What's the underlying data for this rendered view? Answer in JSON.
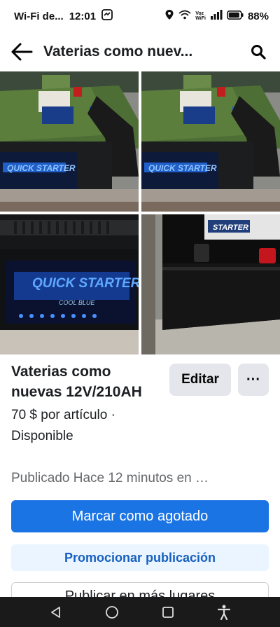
{
  "status_bar": {
    "carrier": "Wi-Fi de...",
    "time": "12:01",
    "voz_line1": "Voz",
    "voz_line2": "WiFi",
    "battery": "88%"
  },
  "header": {
    "title": "Vaterias como nuev..."
  },
  "photos": {
    "brand_text": "QUICK STARTER",
    "brand_sub": "COOL BLUE",
    "label_small": "STARTER"
  },
  "listing": {
    "title": "Vaterias como nuevas 12V/210AH",
    "edit_label": "Editar",
    "more_label": "···",
    "price_line": "70 $ por artículo ·",
    "status": "Disponible",
    "published": "Publicado Hace 12 minutos en …"
  },
  "actions": {
    "mark_sold": "Marcar como agotado",
    "promote": "Promocionar publicación",
    "publish_more": "Publicar en más lugares"
  },
  "colors": {
    "primary": "#1b74e4",
    "promote_bg": "#ebf5ff",
    "promote_text": "#1660bf"
  }
}
